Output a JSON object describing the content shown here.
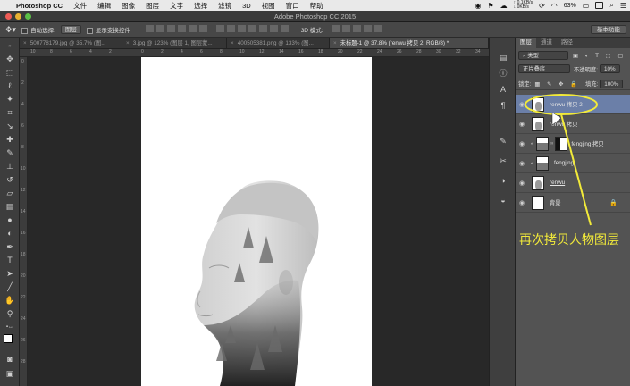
{
  "menubar": {
    "app": "Photoshop CC",
    "items": [
      "文件",
      "编辑",
      "图像",
      "图层",
      "文字",
      "选择",
      "滤镜",
      "3D",
      "视图",
      "窗口",
      "帮助"
    ],
    "net_up": "0.1KB/s",
    "net_down": "0KB/s",
    "battery": "63%"
  },
  "window": {
    "title": "Adobe Photoshop CC 2015"
  },
  "options": {
    "auto_select_label": "自动选择:",
    "auto_select_value": "图层",
    "show_transform_label": "显示变换控件",
    "mode_3d": "3D 模式:",
    "workspace": "基本功能"
  },
  "tabs": [
    {
      "label": "500778179.jpg @ 35.7% (图...",
      "active": false
    },
    {
      "label": "3.jpg @ 123% (图层 1, 图层蒙...",
      "active": false
    },
    {
      "label": "400505381.png @ 133% (图...",
      "active": false
    },
    {
      "label": "未标题-1 @ 37.8% (renwu 拷贝 2, RGB/8) *",
      "active": true
    }
  ],
  "ruler": {
    "h": [
      "10",
      "8",
      "6",
      "4",
      "2",
      "0",
      "2",
      "4",
      "6",
      "8",
      "10",
      "12",
      "14",
      "16",
      "18",
      "20",
      "22",
      "24",
      "26",
      "28",
      "30",
      "32",
      "34"
    ],
    "v": [
      "0",
      "2",
      "4",
      "6",
      "8",
      "10",
      "12",
      "14",
      "16",
      "18",
      "20",
      "22",
      "24",
      "26",
      "28"
    ]
  },
  "panel": {
    "tabs": [
      "图层",
      "通道",
      "路径"
    ],
    "filter_kind": "类型",
    "blend_mode": "正片叠底",
    "opacity_label": "不透明度:",
    "opacity_value": "10%",
    "lock_label": "锁定:",
    "fill_label": "填充:",
    "fill_value": "100%",
    "layers": [
      {
        "name": "renwu 拷贝 2",
        "selected": true
      },
      {
        "name": "renwu 拷贝",
        "selected": false
      },
      {
        "name": "fengjing 拷贝",
        "selected": false
      },
      {
        "name": "fengjing",
        "selected": false
      },
      {
        "name": "renwu",
        "selected": false
      },
      {
        "name": "背景",
        "selected": false
      }
    ]
  },
  "annotation": {
    "text": "再次拷贝人物图层",
    "color": "#f2ea3a"
  },
  "icons": {
    "tools": [
      "move-icon",
      "marquee-icon",
      "lasso-icon",
      "magic-wand-icon",
      "crop-icon",
      "eyedropper-icon",
      "healing-icon",
      "brush-icon",
      "stamp-icon",
      "history-brush-icon",
      "eraser-icon",
      "gradient-icon",
      "blur-icon",
      "dodge-icon",
      "pen-icon",
      "type-icon",
      "path-select-icon",
      "shape-icon",
      "hand-icon",
      "zoom-icon"
    ],
    "panel_strip": [
      "history-icon",
      "info-icon",
      "character-icon",
      "paragraph-icon",
      "brush-panel-icon",
      "clone-source-icon",
      "adjustments-icon",
      "styles-icon"
    ]
  }
}
